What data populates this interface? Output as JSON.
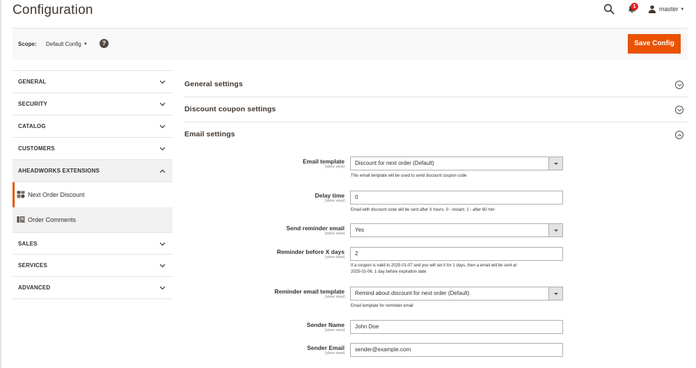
{
  "header": {
    "title": "Configuration",
    "notification_count": "1",
    "user_name": "master",
    "user_caret": "▾"
  },
  "scope": {
    "label": "Scope:",
    "value": "Default Config",
    "caret": "▾",
    "help": "?"
  },
  "toolbar": {
    "save_label": "Save Config"
  },
  "sidebar": {
    "tabs": [
      {
        "label": "GENERAL",
        "icon": "chevron-down-icon"
      },
      {
        "label": "SECURITY",
        "icon": "chevron-down-icon"
      },
      {
        "label": "CATALOG",
        "icon": "chevron-down-icon"
      },
      {
        "label": "CUSTOMERS",
        "icon": "chevron-down-icon"
      },
      {
        "label": "AHEADWORKS EXTENSIONS",
        "icon": "chevron-up-icon"
      },
      {
        "label": "SALES",
        "icon": "chevron-down-icon"
      },
      {
        "label": "SERVICES",
        "icon": "chevron-down-icon"
      },
      {
        "label": "ADVANCED",
        "icon": "chevron-down-icon"
      }
    ],
    "sub_items": [
      {
        "label": "Next Order Discount",
        "icon": "next-order-discount-icon"
      },
      {
        "label": "Order Comments",
        "icon": "order-comments-icon"
      }
    ]
  },
  "sections": [
    {
      "title": "General settings",
      "state": "collapsed"
    },
    {
      "title": "Discount coupon settings",
      "state": "collapsed"
    },
    {
      "title": "Email settings",
      "state": "expanded"
    }
  ],
  "scope_hint": "[store view]",
  "form": {
    "email_template": {
      "label": "Email template",
      "value": "Discount for next order (Default)",
      "note": "This email template will be used to send discount coupon code"
    },
    "delay_time": {
      "label": "Delay time",
      "value": "0",
      "note": "Email with discount code will be sent after X hours. 0 - instant. 1 - after 60 min"
    },
    "send_reminder": {
      "label": "Send reminder email",
      "value": "Yes"
    },
    "reminder_days": {
      "label": "Reminder before X days",
      "value": "2",
      "note_line1": "If a coupon is valid to 2025-01-07 and you will set it for 1 days, then a email will be sent at",
      "note_line2": "2025-01-06, 1 day before expiration date"
    },
    "reminder_template": {
      "label": "Reminder email template",
      "value": "Remind about discount for next order (Default)",
      "note": "Email template for reminder email"
    },
    "sender_name": {
      "label": "Sender Name",
      "value": "John Doe"
    },
    "sender_email": {
      "label": "Sender Email",
      "value": "sender@example.com"
    }
  },
  "colors": {
    "accent": "#eb5202",
    "badge": "#e22626",
    "text": "#303030"
  }
}
